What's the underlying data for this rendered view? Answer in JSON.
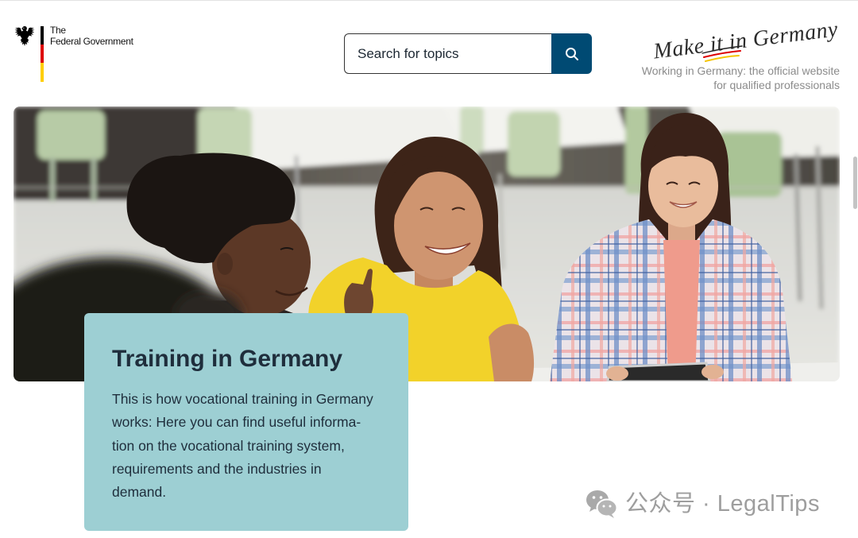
{
  "header": {
    "government": {
      "line1": "The",
      "line2": "Federal Government",
      "emblem_icon": "federal-eagle-icon"
    },
    "search": {
      "placeholder": "Search for topics",
      "value": "",
      "button_icon": "search-icon"
    },
    "brand": {
      "logo_text": "Make it in Germany",
      "tagline_line1": "Working in Germany: the official website",
      "tagline_line2": "for qualified professionals"
    }
  },
  "hero": {
    "card": {
      "title": "Training in Germany",
      "description_lines": [
        "This is how vocational training in Germany",
        "works: Here you can find useful informa-",
        "tion on the vocational training system,",
        "requirements and the industries in",
        "demand."
      ]
    }
  },
  "watermark": {
    "icon": "wechat-icon",
    "text": "公众号 · LegalTips"
  },
  "colors": {
    "accent": "#004a73",
    "card_background": "#9dcfd3",
    "text_dark": "#1f2e3c",
    "tagline": "#8b8b8b",
    "flag_black": "#000000",
    "flag_red": "#dd0000",
    "flag_gold": "#ffce00"
  }
}
